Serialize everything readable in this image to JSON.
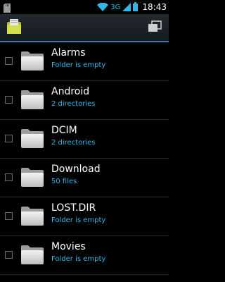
{
  "status_bar": {
    "network": "3G",
    "time": "18:43",
    "icons": [
      "sd-card-icon",
      "wifi-icon",
      "signal-icon",
      "battery-icon"
    ],
    "accent": "#33b5e5"
  },
  "action_bar": {
    "app_icon": "file-manager-icon",
    "menu_icon": "copy-icon",
    "divider_color": "#2c7fa8"
  },
  "folders": [
    {
      "name": "Alarms",
      "detail": "Folder is empty"
    },
    {
      "name": "Android",
      "detail": "2 directories"
    },
    {
      "name": "DCIM",
      "detail": "2 directories"
    },
    {
      "name": "Download",
      "detail": "50 files"
    },
    {
      "name": "LOST.DIR",
      "detail": "Folder is empty"
    },
    {
      "name": "Movies",
      "detail": "Folder is empty"
    }
  ]
}
